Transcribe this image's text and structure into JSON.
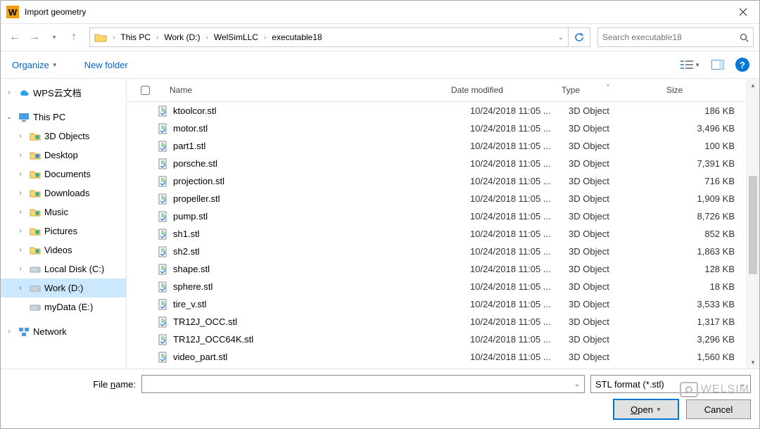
{
  "window": {
    "title": "Import geometry"
  },
  "breadcrumbs": [
    "This PC",
    "Work (D:)",
    "WelSimLLC",
    "executable18"
  ],
  "search": {
    "placeholder": "Search executable18"
  },
  "toolbar": {
    "organize": "Organize",
    "new_folder": "New folder"
  },
  "columns": {
    "name": "Name",
    "date": "Date modified",
    "type": "Type",
    "size": "Size"
  },
  "tree": [
    {
      "label": "WPS云文档",
      "icon": "cloud",
      "twisty": ">",
      "indent": 0
    },
    {
      "label": "",
      "icon": "",
      "twisty": "",
      "indent": 0
    },
    {
      "label": "This PC",
      "icon": "pc",
      "twisty": "v",
      "indent": 0
    },
    {
      "label": "3D Objects",
      "icon": "folder3d",
      "twisty": ">",
      "indent": 1
    },
    {
      "label": "Desktop",
      "icon": "desktop",
      "twisty": ">",
      "indent": 1
    },
    {
      "label": "Documents",
      "icon": "documents",
      "twisty": ">",
      "indent": 1
    },
    {
      "label": "Downloads",
      "icon": "downloads",
      "twisty": ">",
      "indent": 1
    },
    {
      "label": "Music",
      "icon": "music",
      "twisty": ">",
      "indent": 1
    },
    {
      "label": "Pictures",
      "icon": "pictures",
      "twisty": ">",
      "indent": 1
    },
    {
      "label": "Videos",
      "icon": "videos",
      "twisty": ">",
      "indent": 1
    },
    {
      "label": "Local Disk (C:)",
      "icon": "disk",
      "twisty": ">",
      "indent": 1
    },
    {
      "label": "Work (D:)",
      "icon": "disk",
      "twisty": ">",
      "indent": 1,
      "selected": true
    },
    {
      "label": "myData (E:)",
      "icon": "disk",
      "twisty": "",
      "indent": 1
    },
    {
      "label": "",
      "icon": "",
      "twisty": "",
      "indent": 0
    },
    {
      "label": "Network",
      "icon": "network",
      "twisty": ">",
      "indent": 0
    }
  ],
  "files": [
    {
      "name": "ktoolcor.stl",
      "date": "10/24/2018 11:05 ...",
      "type": "3D Object",
      "size": "186 KB"
    },
    {
      "name": "motor.stl",
      "date": "10/24/2018 11:05 ...",
      "type": "3D Object",
      "size": "3,496 KB"
    },
    {
      "name": "part1.stl",
      "date": "10/24/2018 11:05 ...",
      "type": "3D Object",
      "size": "100 KB"
    },
    {
      "name": "porsche.stl",
      "date": "10/24/2018 11:05 ...",
      "type": "3D Object",
      "size": "7,391 KB"
    },
    {
      "name": "projection.stl",
      "date": "10/24/2018 11:05 ...",
      "type": "3D Object",
      "size": "716 KB"
    },
    {
      "name": "propeller.stl",
      "date": "10/24/2018 11:05 ...",
      "type": "3D Object",
      "size": "1,909 KB"
    },
    {
      "name": "pump.stl",
      "date": "10/24/2018 11:05 ...",
      "type": "3D Object",
      "size": "8,726 KB"
    },
    {
      "name": "sh1.stl",
      "date": "10/24/2018 11:05 ...",
      "type": "3D Object",
      "size": "852 KB"
    },
    {
      "name": "sh2.stl",
      "date": "10/24/2018 11:05 ...",
      "type": "3D Object",
      "size": "1,863 KB"
    },
    {
      "name": "shape.stl",
      "date": "10/24/2018 11:05 ...",
      "type": "3D Object",
      "size": "128 KB"
    },
    {
      "name": "sphere.stl",
      "date": "10/24/2018 11:05 ...",
      "type": "3D Object",
      "size": "18 KB"
    },
    {
      "name": "tire_v.stl",
      "date": "10/24/2018 11:05 ...",
      "type": "3D Object",
      "size": "3,533 KB"
    },
    {
      "name": "TR12J_OCC.stl",
      "date": "10/24/2018 11:05 ...",
      "type": "3D Object",
      "size": "1,317 KB"
    },
    {
      "name": "TR12J_OCC64K.stl",
      "date": "10/24/2018 11:05 ...",
      "type": "3D Object",
      "size": "3,296 KB"
    },
    {
      "name": "video_part.stl",
      "date": "10/24/2018 11:05 ...",
      "type": "3D Object",
      "size": "1,560 KB"
    }
  ],
  "footer": {
    "filename_label_pre": "File ",
    "filename_label_u": "n",
    "filename_label_post": "ame:",
    "filter": "STL format (*.stl)",
    "open_u": "O",
    "open_post": "pen",
    "cancel": "Cancel"
  },
  "watermark": "WELSIM"
}
